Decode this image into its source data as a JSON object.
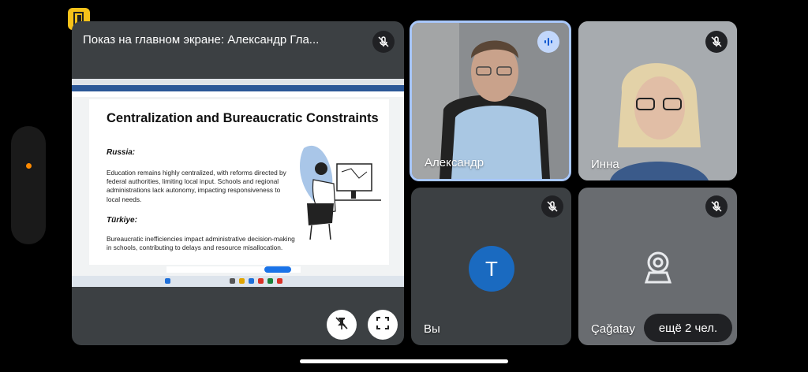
{
  "presentation": {
    "title": "Показ на главном экране: Александр Гла...",
    "slide": {
      "heading": "Centralization and Bureaucratic Constraints",
      "section1_title": "Russia:",
      "section1_text": "Education remains highly centralized, with reforms directed by federal authorities, limiting local input. Schools and regional administrations lack autonomy, impacting responsiveness to local needs.",
      "section2_title": "Türkiye:",
      "section2_text": "Bureaucratic inefficiencies impact administrative decision-making in schools, contributing to delays and resource misallocation."
    }
  },
  "participants": {
    "alexander": {
      "name": "Александр"
    },
    "inna": {
      "name": "Инна"
    },
    "you": {
      "name": "Вы",
      "initial": "T"
    },
    "cagatay": {
      "name": "Çağatay"
    }
  },
  "more": {
    "label": "ещё 2 чел."
  },
  "icons": {
    "badge": "door-icon",
    "mic_off": "mic-off-icon",
    "speaking": "audio-level-icon",
    "unpin": "unpin-icon",
    "fullscreen": "fullscreen-icon",
    "camera_off": "camera-off-icon"
  },
  "colors": {
    "badge": "#f6c21a",
    "speaking_border": "#a8c7fa",
    "avatar": "#1a6ac0",
    "tile_bg": "#3c4043",
    "indicator_dot": "#ff8a00"
  }
}
